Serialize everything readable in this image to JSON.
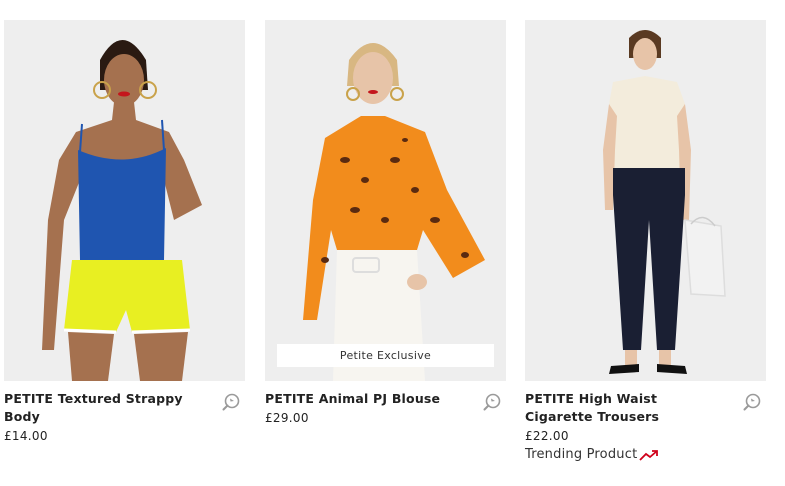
{
  "products": [
    {
      "title": "PETITE Textured Strappy Body",
      "price": "£14.00"
    },
    {
      "title": "PETITE Animal PJ Blouse",
      "price": "£29.00",
      "badge": "Petite Exclusive"
    },
    {
      "title": "PETITE High Waist Cigarette Trousers",
      "price": "£22.00",
      "trending": "Trending Product"
    }
  ],
  "icons": {
    "quick_view": "quick-view-magnifier-icon",
    "trending": "trending-arrow-icon"
  },
  "colors": {
    "trending_arrow": "#d0021b",
    "image_bg": "#eeeeee"
  }
}
